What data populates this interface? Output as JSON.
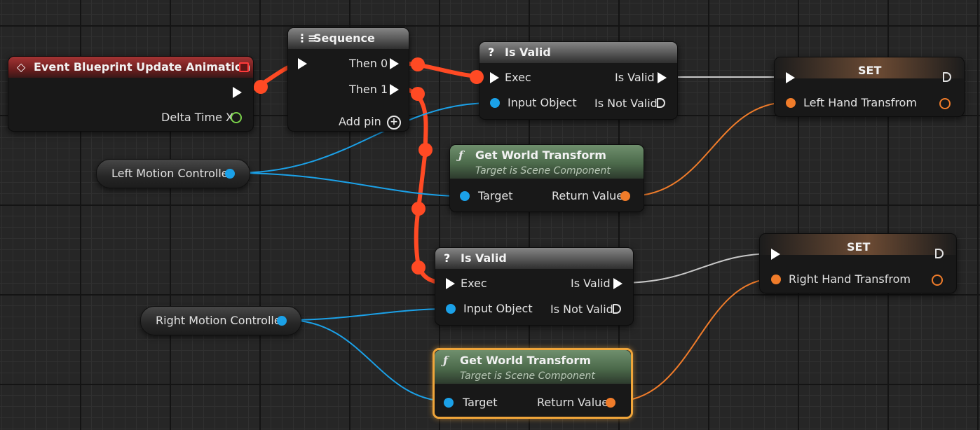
{
  "nodes": {
    "event_update": {
      "title": "Event Blueprint Update Animation",
      "delta_label": "Delta Time X"
    },
    "sequence": {
      "title": "Sequence",
      "then0": "Then 0",
      "then1": "Then 1",
      "add_pin": "Add pin"
    },
    "is_valid_1": {
      "title": "Is Valid",
      "exec": "Exec",
      "is_valid": "Is Valid",
      "input_object": "Input Object",
      "is_not_valid": "Is Not Valid"
    },
    "is_valid_2": {
      "title": "Is Valid",
      "exec": "Exec",
      "is_valid": "Is Valid",
      "input_object": "Input Object",
      "is_not_valid": "Is Not Valid"
    },
    "get_world_transform_1": {
      "title": "Get World Transform",
      "subtitle": "Target is Scene Component",
      "target": "Target",
      "return_value": "Return Value"
    },
    "get_world_transform_2": {
      "title": "Get World Transform",
      "subtitle": "Target is Scene Component",
      "target": "Target",
      "return_value": "Return Value"
    },
    "set_left": {
      "title": "SET",
      "variable": "Left Hand Transfrom"
    },
    "set_right": {
      "title": "SET",
      "variable": "Right Hand Transfrom"
    },
    "var_left": {
      "label": "Left Motion Controller"
    },
    "var_right": {
      "label": "Right Motion Controller"
    }
  },
  "colors": {
    "exec_wire": "#ff4a24",
    "object_wire": "#1ba1e8",
    "transform_wire": "#f07c2a",
    "bool_wire": "#c8c8c8",
    "selection": "#f0a53a"
  },
  "icons": {
    "event": "diamond-icon",
    "sequence": "sequence-icon",
    "is_valid": "question-icon",
    "function": "function-icon",
    "add": "plus-circle-icon"
  }
}
